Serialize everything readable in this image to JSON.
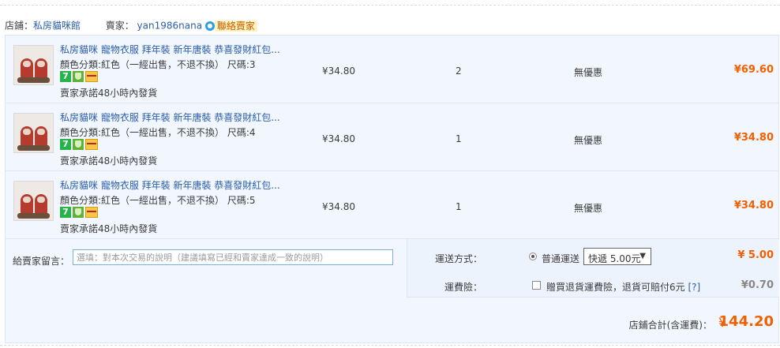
{
  "shop": {
    "label": "店鋪：",
    "name": "私房貓咪館",
    "seller_label": "賣家：",
    "seller_name": "yan1986nana",
    "contact_label": "聯絡賣家"
  },
  "items": [
    {
      "title": "私房貓咪 寵物衣服 拜年裝 新年唐裝 恭喜發財紅包...",
      "spec": "顏色分類:紅色（一經出售，不退不換）  尺碼:3",
      "promise": "賣家承諾48小時內發貨",
      "price": "¥34.80",
      "qty": "2",
      "discount": "無優惠",
      "subtotal": "¥69.60"
    },
    {
      "title": "私房貓咪 寵物衣服 拜年裝 新年唐裝 恭喜發財紅包...",
      "spec": "顏色分類:紅色（一經出售，不退不換）  尺碼:4",
      "promise": "賣家承諾48小時內發貨",
      "price": "¥34.80",
      "qty": "1",
      "discount": "無優惠",
      "subtotal": "¥34.80"
    },
    {
      "title": "私房貓咪 寵物衣服 拜年裝 新年唐裝 恭喜發財紅包...",
      "spec": "顏色分類:紅色（一經出售，不退不換）  尺碼:5",
      "promise": "賣家承諾48小時內發貨",
      "price": "¥34.80",
      "qty": "1",
      "discount": "無優惠",
      "subtotal": "¥34.80"
    }
  ],
  "message": {
    "label": "給賣家留言：",
    "placeholder": "選填：對本次交易的說明（建議填寫已經和賣家達成一致的說明）"
  },
  "shipping": {
    "label": "運送方式：",
    "option_label": "普通運送",
    "select_value": "快遞 5.00元",
    "fee": "¥ 5.00"
  },
  "insurance": {
    "label": "運費險：",
    "text": "贈買退貨運費險，退貨可賠付6元",
    "help": "[?]",
    "fee": "¥0.70"
  },
  "total": {
    "label": "店鋪合計(含運費)：",
    "currency": "¥",
    "value": "144.20"
  },
  "colors": {
    "accent": "#f06000",
    "link": "#2a5ea8",
    "panel_bg": "#f2f7ff"
  }
}
